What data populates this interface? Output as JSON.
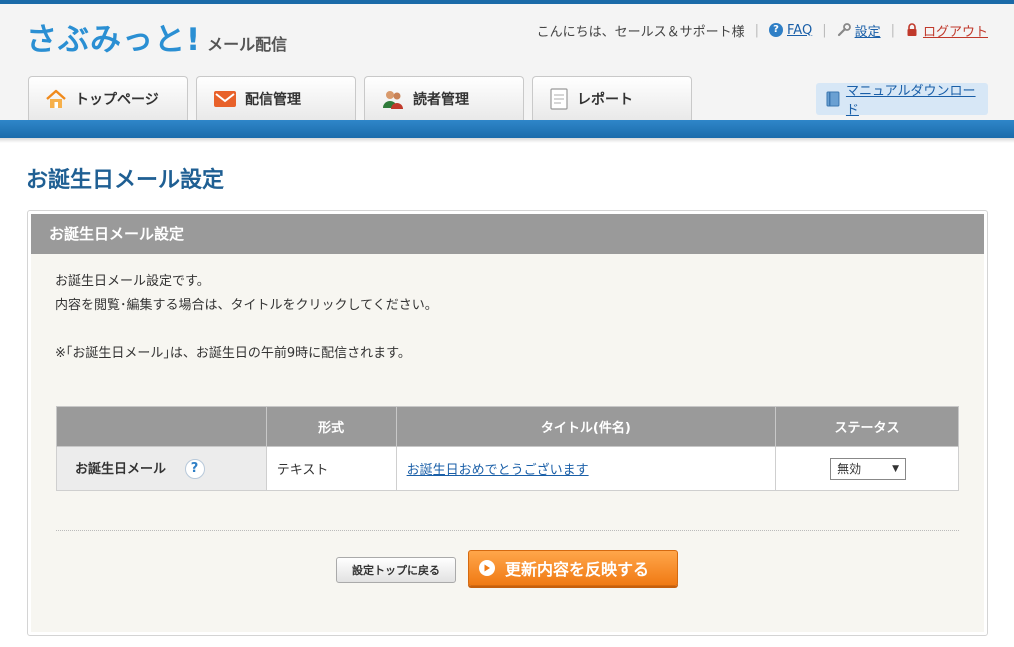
{
  "header": {
    "logo_main": "さぶみっと!",
    "logo_sub": "メール配信",
    "greeting": "こんにちは、セールス＆サポート様",
    "faq_label": "FAQ",
    "settings_label": "設定",
    "logout_label": "ログアウト",
    "manual_label": "マニュアルダウンロード"
  },
  "tabs": [
    {
      "label": "トップページ",
      "icon": "home-icon"
    },
    {
      "label": "配信管理",
      "icon": "mail-icon"
    },
    {
      "label": "読者管理",
      "icon": "users-icon"
    },
    {
      "label": "レポート",
      "icon": "document-icon"
    }
  ],
  "page_title": "お誕生日メール設定",
  "panel": {
    "heading": "お誕生日メール設定",
    "desc_line1": "お誕生日メール設定です。",
    "desc_line2": "内容を閲覧･編集する場合は、タイトルをクリックしてください。",
    "note": "※｢お誕生日メール｣は、お誕生日の午前9時に配信されます。"
  },
  "table": {
    "headers": [
      "",
      "形式",
      "タイトル(件名)",
      "ステータス"
    ],
    "row": {
      "name": "お誕生日メール",
      "format": "テキスト",
      "title": "お誕生日おめでとうございます",
      "status": "無効"
    }
  },
  "buttons": {
    "back_label": "設定トップに戻る",
    "apply_label": "更新内容を反映する"
  },
  "colors": {
    "brand_blue": "#2a8fd3",
    "nav_bar": "#1b6cab",
    "accent_orange": "#f07a14"
  }
}
